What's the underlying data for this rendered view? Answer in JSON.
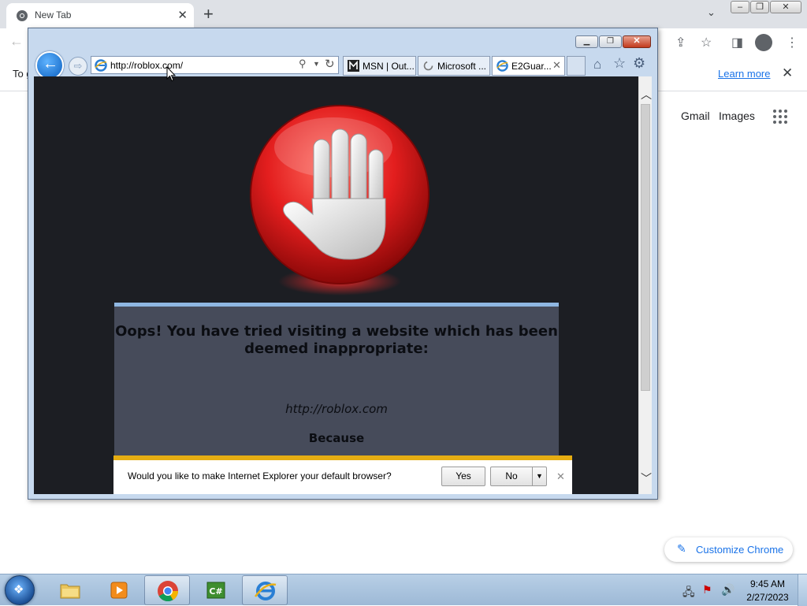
{
  "chrome": {
    "tab_title": "New Tab",
    "infobar_text": "To g",
    "learn_more": "Learn more",
    "gmail": "Gmail",
    "images": "Images",
    "customize_label": "Customize Chrome"
  },
  "ie": {
    "address_url": "http://roblox.com/",
    "tabs": [
      {
        "label": "MSN | Out..."
      },
      {
        "label": "Microsoft ..."
      },
      {
        "label": "E2Guar..."
      }
    ],
    "page": {
      "heading": "Oops! You have tried visiting a website which has been deemed inappropriate:",
      "blocked_url": "http://roblox.com",
      "because": "Because"
    },
    "default_bar": {
      "question": "Would you like to make Internet Explorer your default browser?",
      "yes": "Yes",
      "no": "No"
    }
  },
  "taskbar": {
    "time": "9:45 AM",
    "date": "2/27/2023",
    "csharp_label": "C#"
  },
  "colors": {
    "ie_page_bg": "#1c1e23",
    "block_panel_bg": "#464b5a",
    "block_panel_accent": "#8fb7e2",
    "stop_red": "#e31e1e",
    "infobar_accent": "#e6ad12",
    "chrome_link": "#1a73e8"
  }
}
